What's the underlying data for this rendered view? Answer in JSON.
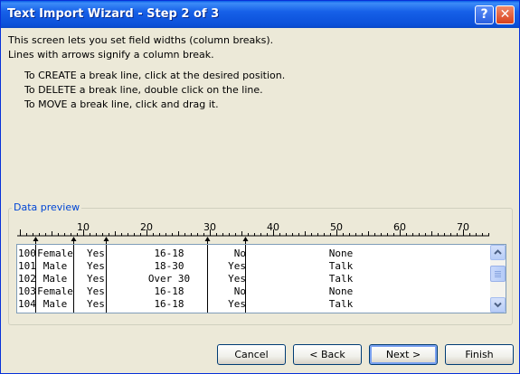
{
  "window": {
    "title": "Text Import Wizard - Step 2 of 3",
    "help_glyph": "?",
    "close_glyph": "✕"
  },
  "intro": {
    "line1": "This screen lets you set field widths (column breaks).",
    "line2": "Lines with arrows signify a column break."
  },
  "instructions": [
    "To CREATE a break line, click at the desired position.",
    "To DELETE a break line, double click on the line.",
    "To MOVE a break line, click and drag it."
  ],
  "preview": {
    "label": "Data preview",
    "ruler_ticks": [
      "10",
      "20",
      "30",
      "40",
      "50",
      "60",
      "70"
    ],
    "rows": [
      {
        "id": "100",
        "gender": "Female",
        "yes": "Yes",
        "age": "16-18",
        "flag": "No",
        "talk": "None"
      },
      {
        "id": "101",
        "gender": "Male",
        "yes": "Yes",
        "age": "18-30",
        "flag": "Yes",
        "talk": "Talk"
      },
      {
        "id": "102",
        "gender": "Male",
        "yes": "Yes",
        "age": "Over 30",
        "flag": "Yes",
        "talk": "Talk"
      },
      {
        "id": "103",
        "gender": "Female",
        "yes": "Yes",
        "age": "16-18",
        "flag": "No",
        "talk": "None"
      },
      {
        "id": "104",
        "gender": "Male",
        "yes": "Yes",
        "age": "16-18",
        "flag": "Yes",
        "talk": "Talk"
      }
    ]
  },
  "buttons": {
    "cancel": "Cancel",
    "back": "< Back",
    "next": "Next >",
    "finish": "Finish"
  },
  "colors": {
    "title_bar": "#0a5fe8",
    "window_bg": "#ece9d8",
    "group_label": "#0046d5",
    "default_button_ring": "#7aa1f0"
  },
  "icons": {
    "help": "help-icon",
    "close": "close-icon",
    "scroll_up": "chevron-up-icon",
    "scroll_down": "chevron-down-icon",
    "break_arrow": "arrow-up-icon"
  }
}
